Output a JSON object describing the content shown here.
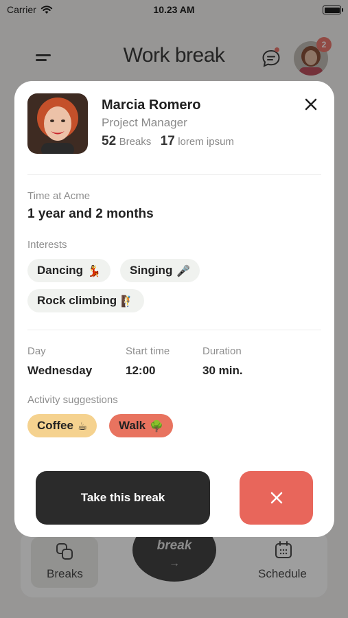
{
  "status_bar": {
    "carrier": "Carrier",
    "time": "10.23 AM"
  },
  "header": {
    "title": "Work break",
    "notification_count": "2",
    "menu_icon": "hamburger-icon",
    "chat_icon": "chat-bubble-icon"
  },
  "bottom_nav": {
    "breaks_label": "Breaks",
    "center_label": "break",
    "center_arrow": "→",
    "schedule_label": "Schedule"
  },
  "profile": {
    "name": "Marcia Romero",
    "role": "Project Manager",
    "breaks_count": "52",
    "breaks_label": "Breaks",
    "other_count": "17",
    "other_label": "lorem ipsum"
  },
  "time_at": {
    "label": "Time at Acme",
    "value": "1 year and 2 months"
  },
  "interests": {
    "label": "Interests",
    "items": [
      {
        "text": "Dancing",
        "emoji": "💃"
      },
      {
        "text": "Singing",
        "emoji": "🎤"
      },
      {
        "text": "Rock climbing",
        "emoji": "🧗"
      }
    ]
  },
  "schedule": {
    "day_label": "Day",
    "day_value": "Wednesday",
    "start_label": "Start time",
    "start_value": "12:00",
    "duration_label": "Duration",
    "duration_value": "30 min."
  },
  "suggestions": {
    "label": "Activity suggestions",
    "items": [
      {
        "text": "Coffee",
        "emoji": "☕",
        "color": "#f5d28f"
      },
      {
        "text": "Walk",
        "emoji": "🌳",
        "color": "#e8735f"
      }
    ]
  },
  "actions": {
    "take_label": "Take this break",
    "dismiss_icon": "close-icon"
  },
  "colors": {
    "accent_red": "#e8665b",
    "dark": "#2b2b2b",
    "chip_bg": "#f0f2ef",
    "coffee": "#f5d28f",
    "walk": "#e8735f"
  }
}
